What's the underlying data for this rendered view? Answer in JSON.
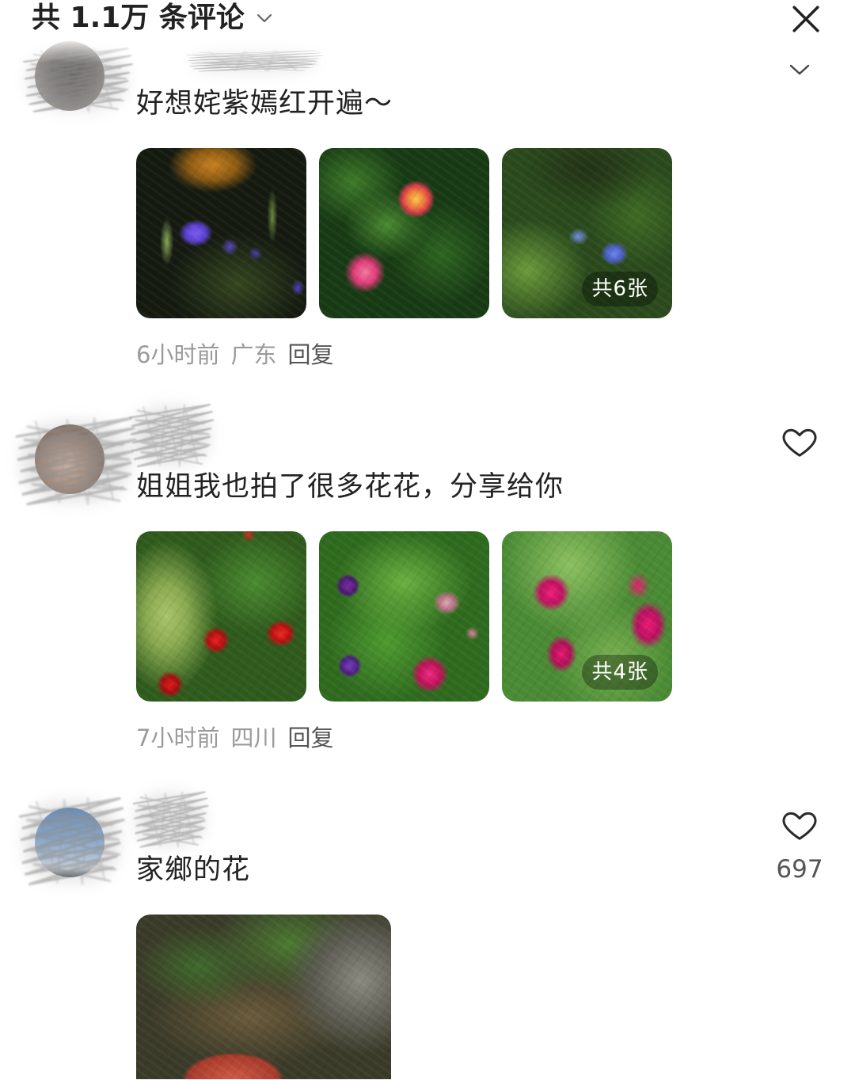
{
  "header": {
    "title": "共 1.1万 条评论",
    "expand_icon": "chevron-down-icon",
    "close_icon": "close-icon"
  },
  "comments": [
    {
      "action_icon": "chevron-down-icon",
      "text": "好想姹紫嫣红开遍～",
      "image_badge": "共6张",
      "time": "6小时前",
      "location": "广东",
      "reply_label": "回复"
    },
    {
      "action_icon": "heart-icon",
      "text": "姐姐我也拍了很多花花，分享给你",
      "image_badge": "共4张",
      "time": "7小时前",
      "location": "四川",
      "reply_label": "回复"
    },
    {
      "action_icon": "heart-icon",
      "like_count": "697",
      "text": "家鄉的花"
    }
  ],
  "colors": {
    "text_primary": "#222222",
    "text_secondary": "#9a9a9a",
    "reply_text": "#555555",
    "badge_bg": "rgba(0,0,0,0.32)"
  }
}
